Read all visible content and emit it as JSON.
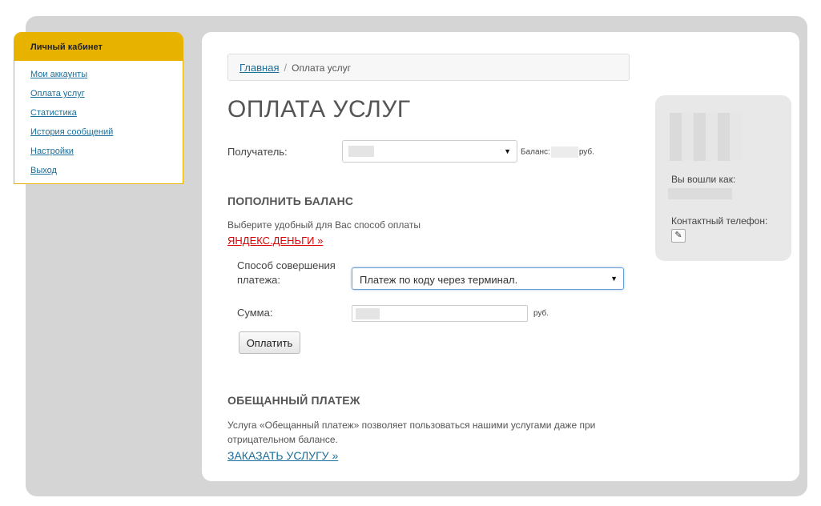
{
  "sidebar": {
    "title": "Личный кабинет",
    "items": [
      {
        "label": "Мои аккаунты"
      },
      {
        "label": "Оплата услуг"
      },
      {
        "label": "Статистика"
      },
      {
        "label": "История сообщений"
      },
      {
        "label": "Настройки"
      },
      {
        "label": "Выход"
      }
    ]
  },
  "breadcrumb": {
    "home": "Главная",
    "separator": "/",
    "current": "Оплата услуг"
  },
  "page_title": "ОПЛАТА УСЛУГ",
  "recipient": {
    "label": "Получатель:",
    "arrow": "▼",
    "balance_label": "Баланс:",
    "balance_unit": "руб."
  },
  "topup": {
    "title": "ПОПОЛНИТЬ БАЛАНС",
    "description": "Выберите удобный для Вас способ оплаты",
    "yandex_link": "ЯНДЕКС.ДЕНЬГИ »",
    "method_label_line1": "Способ совершения",
    "method_label_line2": "платежа:",
    "method_value": "Платеж по коду через терминал.",
    "method_arrow": "▼",
    "sum_label": "Сумма:",
    "sum_unit": "руб.",
    "pay_button": "Оплатить"
  },
  "promised": {
    "title": "ОБЕЩАННЫЙ ПЛАТЕЖ",
    "description_line1": "Услуга «Обещанный платеж» позволяет пользоваться нашими услугами даже при",
    "description_line2": "отрицательном балансе.",
    "order_link": "ЗАКАЗАТЬ УСЛУГУ »"
  },
  "user_panel": {
    "logged_in_label": "Вы вошли как:",
    "phone_label": "Контактный телефон:",
    "edit_icon": "pencil-icon"
  },
  "colors": {
    "accent": "#e8b200",
    "link": "#1a6f9a",
    "yandex_link": "#dd0000",
    "frame_bg": "#d5d5d5"
  }
}
